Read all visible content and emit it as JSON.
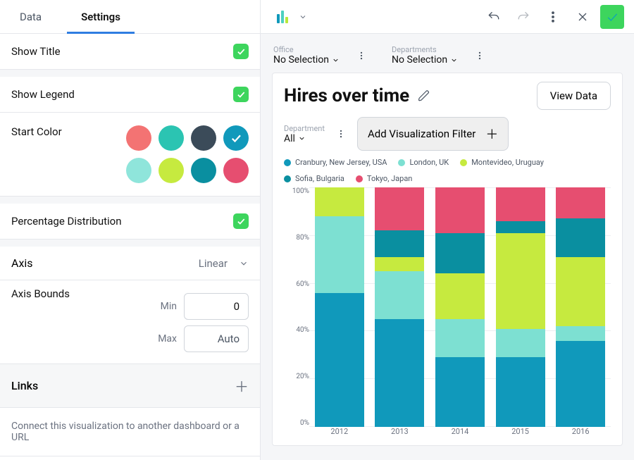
{
  "sidebar": {
    "tabs": {
      "data": "Data",
      "settings": "Settings"
    },
    "show_title": {
      "label": "Show Title",
      "checked": true
    },
    "show_legend": {
      "label": "Show Legend",
      "checked": true
    },
    "start_color": {
      "label": "Start Color",
      "selected_index": 3,
      "colors": [
        "#f37373",
        "#2bc4b2",
        "#3b4b59",
        "#1099bb",
        "#8fe5db",
        "#c6ea3f",
        "#0a8fa0",
        "#e64e70"
      ]
    },
    "percentage_distribution": {
      "label": "Percentage Distribution",
      "checked": true
    },
    "axis": {
      "label": "Axis",
      "value": "Linear"
    },
    "axis_bounds": {
      "label": "Axis Bounds",
      "min_label": "Min",
      "min_value": "0",
      "max_label": "Max",
      "max_value": "Auto"
    },
    "links": {
      "header": "Links",
      "description": "Connect this visualization to another dashboard or a URL"
    }
  },
  "toolbar": {},
  "selectors": {
    "office": {
      "label": "Office",
      "value": "No Selection"
    },
    "departments": {
      "label": "Departments",
      "value": "No Selection"
    }
  },
  "chart": {
    "title": "Hires over time",
    "view_data_label": "View Data",
    "department_label": "Department",
    "department_value": "All",
    "add_filter_label": "Add Visualization Filter",
    "legend": [
      {
        "name": "Cranbury, New Jersey, USA",
        "color": "#1099bb"
      },
      {
        "name": "London, UK",
        "color": "#7de0d2"
      },
      {
        "name": "Montevideo, Uruguay",
        "color": "#c6ea3f"
      },
      {
        "name": "Sofia, Bulgaria",
        "color": "#0a8fa0"
      },
      {
        "name": "Tokyo, Japan",
        "color": "#e64e70"
      }
    ],
    "y_ticks": [
      "100%",
      "80%",
      "60%",
      "40%",
      "20%",
      "0%"
    ]
  },
  "chart_data": {
    "type": "bar_stacked_100",
    "categories": [
      "2012",
      "2013",
      "2014",
      "2015",
      "2016"
    ],
    "series": [
      {
        "name": "Cranbury, New Jersey, USA",
        "color": "#1099bb",
        "values": [
          56,
          45,
          29,
          29,
          36
        ]
      },
      {
        "name": "London, UK",
        "color": "#7de0d2",
        "values": [
          32,
          20,
          16,
          12,
          6
        ]
      },
      {
        "name": "Montevideo, Uruguay",
        "color": "#c6ea3f",
        "values": [
          12,
          6,
          19,
          40,
          29
        ]
      },
      {
        "name": "Sofia, Bulgaria",
        "color": "#0a8fa0",
        "values": [
          0,
          11,
          17,
          5,
          16
        ]
      },
      {
        "name": "Tokyo, Japan",
        "color": "#e64e70",
        "values": [
          0,
          18,
          19,
          14,
          13
        ]
      }
    ],
    "ylim": [
      0,
      100
    ],
    "ylabel": "%",
    "title": "Hires over time"
  }
}
